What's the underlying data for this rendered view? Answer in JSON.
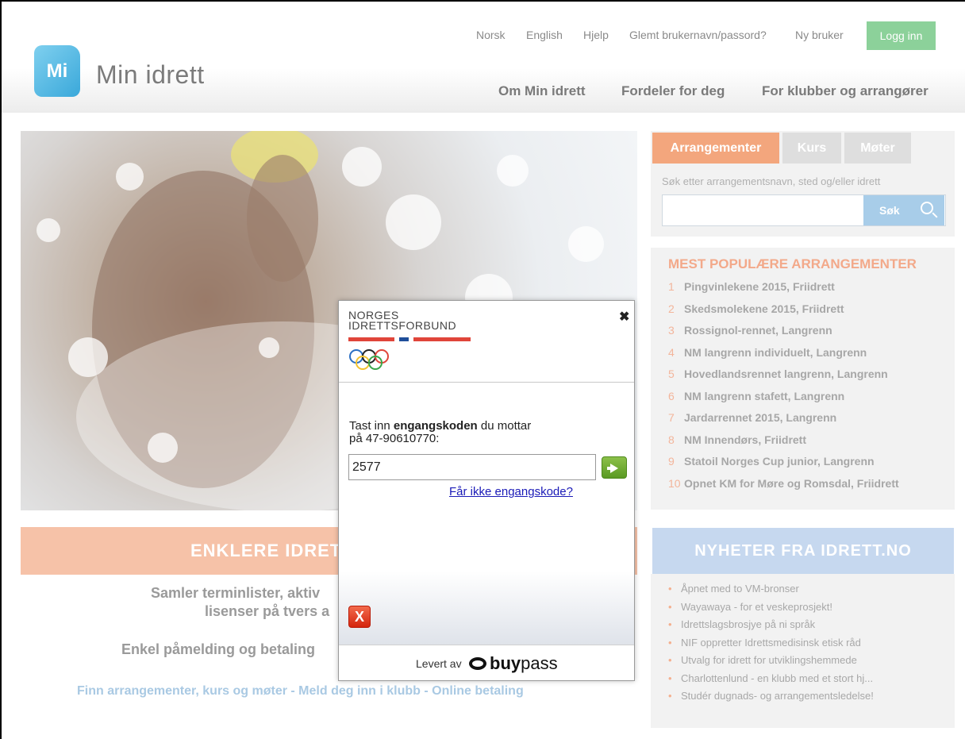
{
  "topbar": {
    "links": [
      "Norsk",
      "English",
      "Hjelp",
      "Glemt brukernavn/passord?",
      "Ny bruker"
    ],
    "login_label": "Logg inn"
  },
  "brand": {
    "badge": "Mi",
    "name": "Min idrett"
  },
  "mainnav": [
    "Om Min idrett",
    "Fordeler for deg",
    "For klubber og arrangører"
  ],
  "banner": {
    "title": "ENKLERE IDRET"
  },
  "body_text": {
    "line1": "Samler terminlister, aktiv",
    "line2": "lisenser på tvers a",
    "line3": "Enkel påmelding og betaling"
  },
  "bottom_links": "Finn arrangementer, kurs og møter - Meld deg inn i klubb - Online betaling",
  "search": {
    "tabs": [
      "Arrangementer",
      "Kurs",
      "Møter"
    ],
    "hint": "Søk etter arrangementsnavn, sted og/eller idrett",
    "button_label": "Søk"
  },
  "popular": {
    "title": "MEST POPULÆRE ARRANGEMENTER",
    "items": [
      {
        "num": "1",
        "text": "Pingvinlekene 2015, Friidrett"
      },
      {
        "num": "2",
        "text": "Skedsmolekene 2015, Friidrett"
      },
      {
        "num": "3",
        "text": "Rossignol-rennet, Langrenn"
      },
      {
        "num": "4",
        "text": "NM langrenn individuelt, Langrenn"
      },
      {
        "num": "5",
        "text": "Hovedlandsrennet langrenn, Langrenn"
      },
      {
        "num": "6",
        "text": "NM langrenn stafett, Langrenn"
      },
      {
        "num": "7",
        "text": "Jardarrennet 2015, Langrenn"
      },
      {
        "num": "8",
        "text": "NM Innendørs, Friidrett"
      },
      {
        "num": "9",
        "text": "Statoil Norges Cup junior, Langrenn"
      },
      {
        "num": "10",
        "text": "Opnet KM for Møre og Romsdal, Friidrett"
      }
    ]
  },
  "news": {
    "title": "NYHETER FRA IDRETT.NO",
    "items": [
      "Åpnet med to VM-bronser",
      "Wayawaya - for et veskeprosjekt!",
      "Idrettslagsbrosjye på ni språk",
      "NIF oppretter Idrettsmedisinsk etisk råd",
      "Utvalg for idrett for utviklingshemmede",
      "Charlottenlund - en klubb med et stort hj...",
      "Studér dugnads- og arrangementsledelse!"
    ]
  },
  "modal": {
    "org_line1": "NORGES",
    "org_line2": "IDRETTSFORBUND",
    "prompt_pre": "Tast inn ",
    "prompt_bold": "engangskoden",
    "prompt_post": " du mottar",
    "prompt_line2": "på 47-90610770:",
    "code_value": "2577",
    "nocode_link": "Får ikke engangskode?",
    "close_symbol": "✖",
    "cancel_symbol": "X",
    "delivered_by": "Levert av",
    "provider_buy": "buy",
    "provider_pass": "pass",
    "colors": {
      "red": "#e0453a",
      "blue": "#1f4e9a"
    }
  }
}
